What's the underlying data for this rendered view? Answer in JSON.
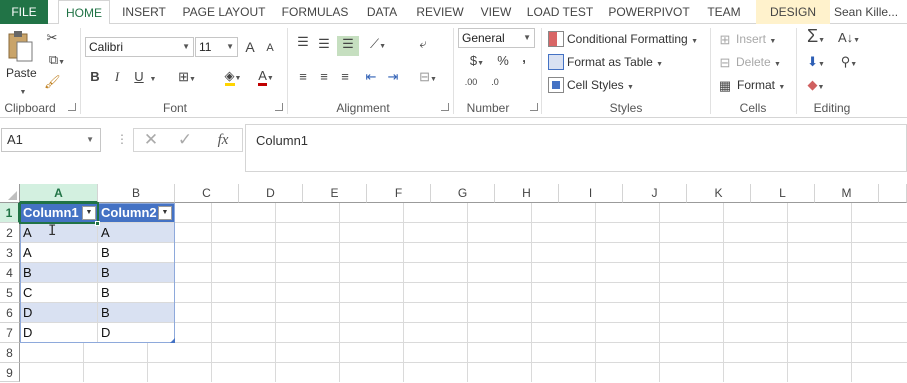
{
  "tabs": [
    "FILE",
    "HOME",
    "INSERT",
    "PAGE LAYOUT",
    "FORMULAS",
    "DATA",
    "REVIEW",
    "VIEW",
    "LOAD TEST",
    "POWERPIVOT",
    "TEAM",
    "DESIGN"
  ],
  "user": "Sean Kille...",
  "clipboard": {
    "paste_label": "Paste",
    "group_label": "Clipboard"
  },
  "font": {
    "name": "Calibri",
    "size": "11",
    "bold": "B",
    "italic": "I",
    "underline": "U",
    "grow": "A",
    "shrink": "A",
    "group_label": "Font"
  },
  "alignment": {
    "group_label": "Alignment"
  },
  "number": {
    "format": "General",
    "currency": "$",
    "percent": "%",
    "comma": ",",
    "inc_dec": ".00",
    "dec_dec": ".0",
    "group_label": "Number"
  },
  "styles": {
    "conditional": "Conditional Formatting",
    "format_table": "Format as Table",
    "cell_styles": "Cell Styles",
    "group_label": "Styles"
  },
  "cells": {
    "insert": "Insert",
    "delete": "Delete",
    "format": "Format",
    "group_label": "Cells"
  },
  "editing": {
    "group_label": "Editing"
  },
  "formula_bar": {
    "name_box": "A1",
    "fx": "fx",
    "formula": "Column1"
  },
  "grid": {
    "columns": [
      "A",
      "B",
      "C",
      "D",
      "E",
      "F",
      "G",
      "H",
      "I",
      "J",
      "K",
      "L",
      "M"
    ],
    "rows": [
      "1",
      "2",
      "3",
      "4",
      "5",
      "6",
      "7",
      "8",
      "9"
    ],
    "table_headers": [
      "Column1",
      "Column2"
    ],
    "table_data": [
      [
        "A",
        "A"
      ],
      [
        "A",
        "B"
      ],
      [
        "B",
        "B"
      ],
      [
        "C",
        "B"
      ],
      [
        "D",
        "B"
      ],
      [
        "D",
        "D"
      ]
    ]
  },
  "colors": {
    "excel_green": "#217346",
    "table_header": "#4472c4",
    "table_band": "#d9e1f2",
    "design_tab": "#fff2cc"
  }
}
